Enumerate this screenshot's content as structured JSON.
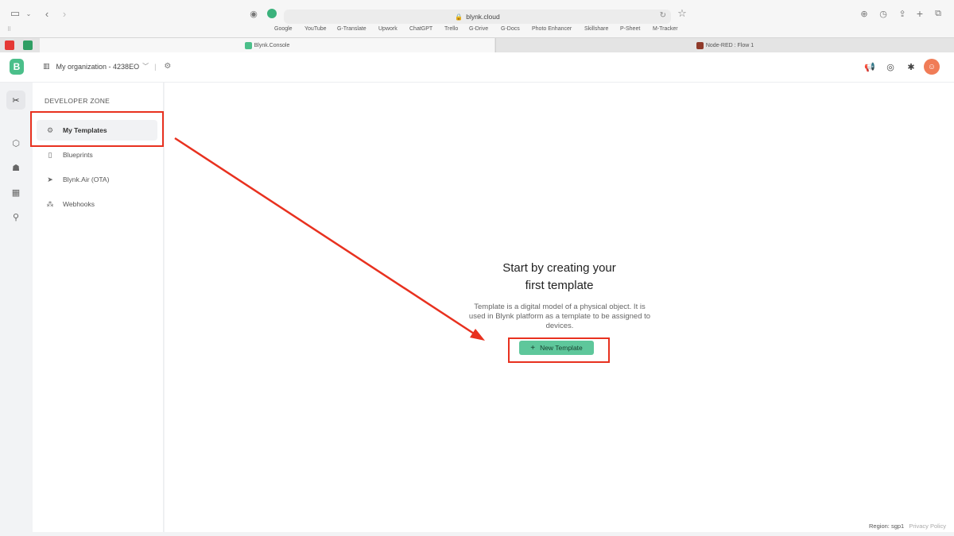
{
  "browser": {
    "address": "blynk.cloud",
    "bookmarks": [
      "Google",
      "YouTube",
      "G-Translate",
      "Upwork",
      "ChatGPT",
      "Trello",
      "G-Drive",
      "G-Docs",
      "Photo Enhancer",
      "Skillshare",
      "P-Sheet",
      "M-Tracker"
    ],
    "tabs": [
      {
        "label": "Blynk.Console"
      },
      {
        "label": "Node-RED : Flow 1"
      }
    ]
  },
  "topbar": {
    "logo_letter": "B",
    "org_name": "My organization - 4238EO"
  },
  "sidebar": {
    "section_title": "DEVELOPER ZONE",
    "items": [
      {
        "label": "My Templates",
        "icon": "templates-icon"
      },
      {
        "label": "Blueprints",
        "icon": "blueprints-icon"
      },
      {
        "label": "Blynk.Air (OTA)",
        "icon": "paper-plane-icon"
      },
      {
        "label": "Webhooks",
        "icon": "webhooks-icon"
      }
    ]
  },
  "main": {
    "empty_title_line1": "Start by creating your",
    "empty_title_line2": "first template",
    "empty_desc": "Template is a digital model of a physical object. It is used in Blynk platform as a template to be assigned to devices.",
    "new_template_button": "New Template"
  },
  "footer": {
    "region": "Region: sgp1",
    "privacy": "Privacy Policy"
  },
  "colors": {
    "accent": "#5ec79b",
    "logo": "#4bbf8a",
    "annotation": "#e8311f",
    "avatar": "#f07c57"
  }
}
